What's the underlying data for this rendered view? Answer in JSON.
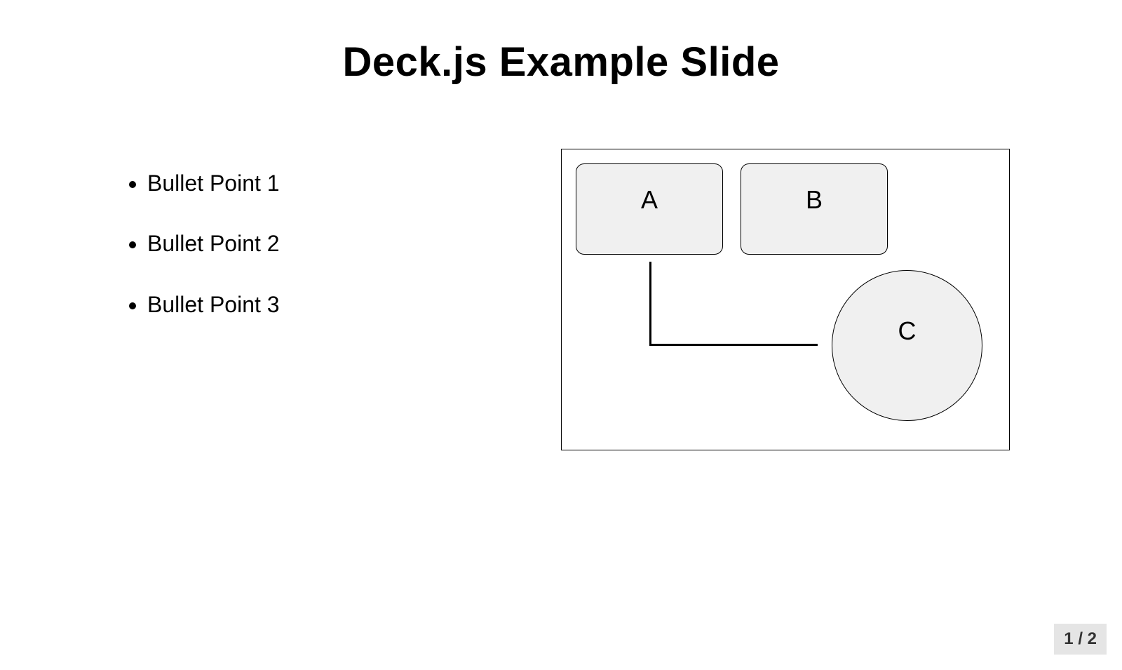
{
  "title": "Deck.js Example Slide",
  "bullets": [
    "Bullet Point 1",
    "Bullet Point 2",
    "Bullet Point 3"
  ],
  "diagram": {
    "nodes": {
      "a": "A",
      "b": "B",
      "c": "C"
    }
  },
  "pagination": {
    "label": "1 / 2",
    "current": 1,
    "total": 2
  }
}
